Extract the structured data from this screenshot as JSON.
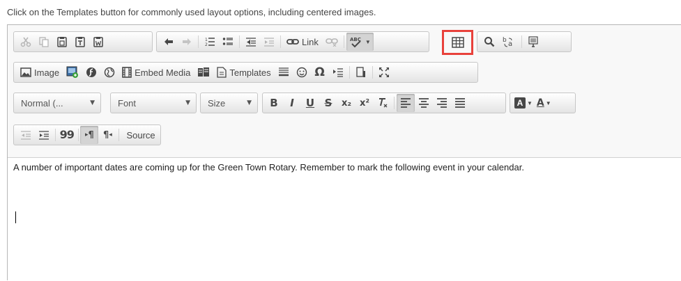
{
  "instruction": "Click on the Templates button for commonly used layout options, including centered images.",
  "toolbar": {
    "row1": {
      "link_label": "Link",
      "buttons": [
        "cut-icon",
        "copy-icon",
        "paste-icon",
        "paste-text-icon",
        "paste-word-icon",
        "undo-icon",
        "redo-icon",
        "numbered-list-icon",
        "bulleted-list-icon",
        "decrease-indent-icon",
        "increase-indent-icon",
        "link-icon",
        "unlink-icon",
        "spellcheck-icon",
        "table-icon",
        "find-icon",
        "replace-icon",
        "show-blocks-icon"
      ],
      "highlighted": "table-icon"
    },
    "row2": {
      "image_label": "Image",
      "embed_media_label": "Embed Media",
      "templates_label": "Templates"
    },
    "row3": {
      "format_value": "Normal (...",
      "font_value": "Font",
      "size_value": "Size",
      "bold": "B",
      "italic": "I",
      "underline": "U",
      "strike": "S",
      "subscript": "x₂",
      "superscript": "x²",
      "text_color": "A",
      "bg_color": "A"
    },
    "row4": {
      "blockquote": "99",
      "ltr": "¶",
      "rtl": "¶",
      "source_label": "Source"
    }
  },
  "content": {
    "paragraph": "A number of important dates are coming up for the Green Town Rotary. Remember to mark the following event in your calendar."
  },
  "colors": {
    "highlight_border": "#e8413b",
    "toolbar_bg": "#f8f8f8"
  }
}
